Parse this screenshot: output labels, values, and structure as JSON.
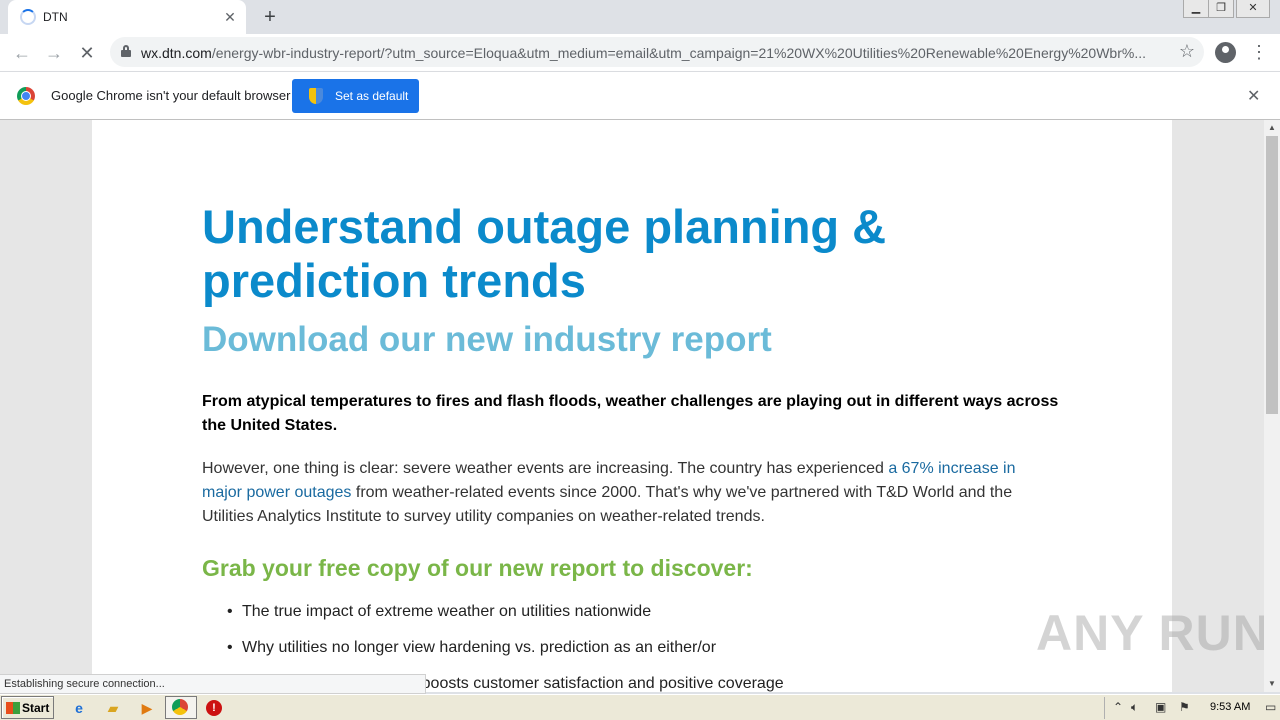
{
  "browser": {
    "tab_title": "DTN",
    "new_tab_symbol": "+",
    "url_host": "wx.dtn.com",
    "url_path": "/energy-wbr-industry-report/?utm_source=Eloqua&utm_medium=email&utm_campaign=21%20WX%20Utilities%20Renewable%20Energy%20Wbr%...",
    "infobar_text": "Google Chrome isn't your default browser",
    "set_default_label": "Set as default",
    "status_text": "Establishing secure connection..."
  },
  "page": {
    "headline": "Understand outage planning & prediction trends",
    "subheadline": "Download our new industry report",
    "intro": "From atypical temperatures to fires and flash floods, weather challenges are playing out in different ways across the United States.",
    "para_before_link": "However, one thing is clear: severe weather events are increasing. The country has experienced ",
    "para_link": "a 67% increase in major power outages",
    "para_after_link": " from weather-related events since 2000. That's why we've partnered with T&D World and the Utilities Analytics Institute to survey utility companies on weather-related trends.",
    "discover_heading": "Grab your free copy of our new report to discover:",
    "bullets": [
      "The true impact of extreme weather on utilities nationwide",
      "Why utilities no longer view hardening vs. prediction as an either/or",
      "How weather technology boosts customer satisfaction and positive coverage"
    ]
  },
  "watermark": "ANY RUN",
  "taskbar": {
    "start_label": "Start",
    "clock": "9:53 AM"
  },
  "colors": {
    "headline": "#0b8acb",
    "subheadline": "#6bbbd8",
    "discover_heading": "#7ab648",
    "link": "#1a6aa0",
    "set_default_button": "#1a73e8"
  },
  "icons": [
    "reload-spinner-icon",
    "close-icon",
    "back-icon",
    "forward-icon",
    "stop-icon",
    "lock-icon",
    "star-icon",
    "profile-icon",
    "menu-icon",
    "chrome-logo-icon",
    "shield-icon",
    "windows-flag-icon",
    "ie-icon",
    "folder-icon",
    "media-player-icon",
    "chrome-icon",
    "stop-sign-icon"
  ]
}
